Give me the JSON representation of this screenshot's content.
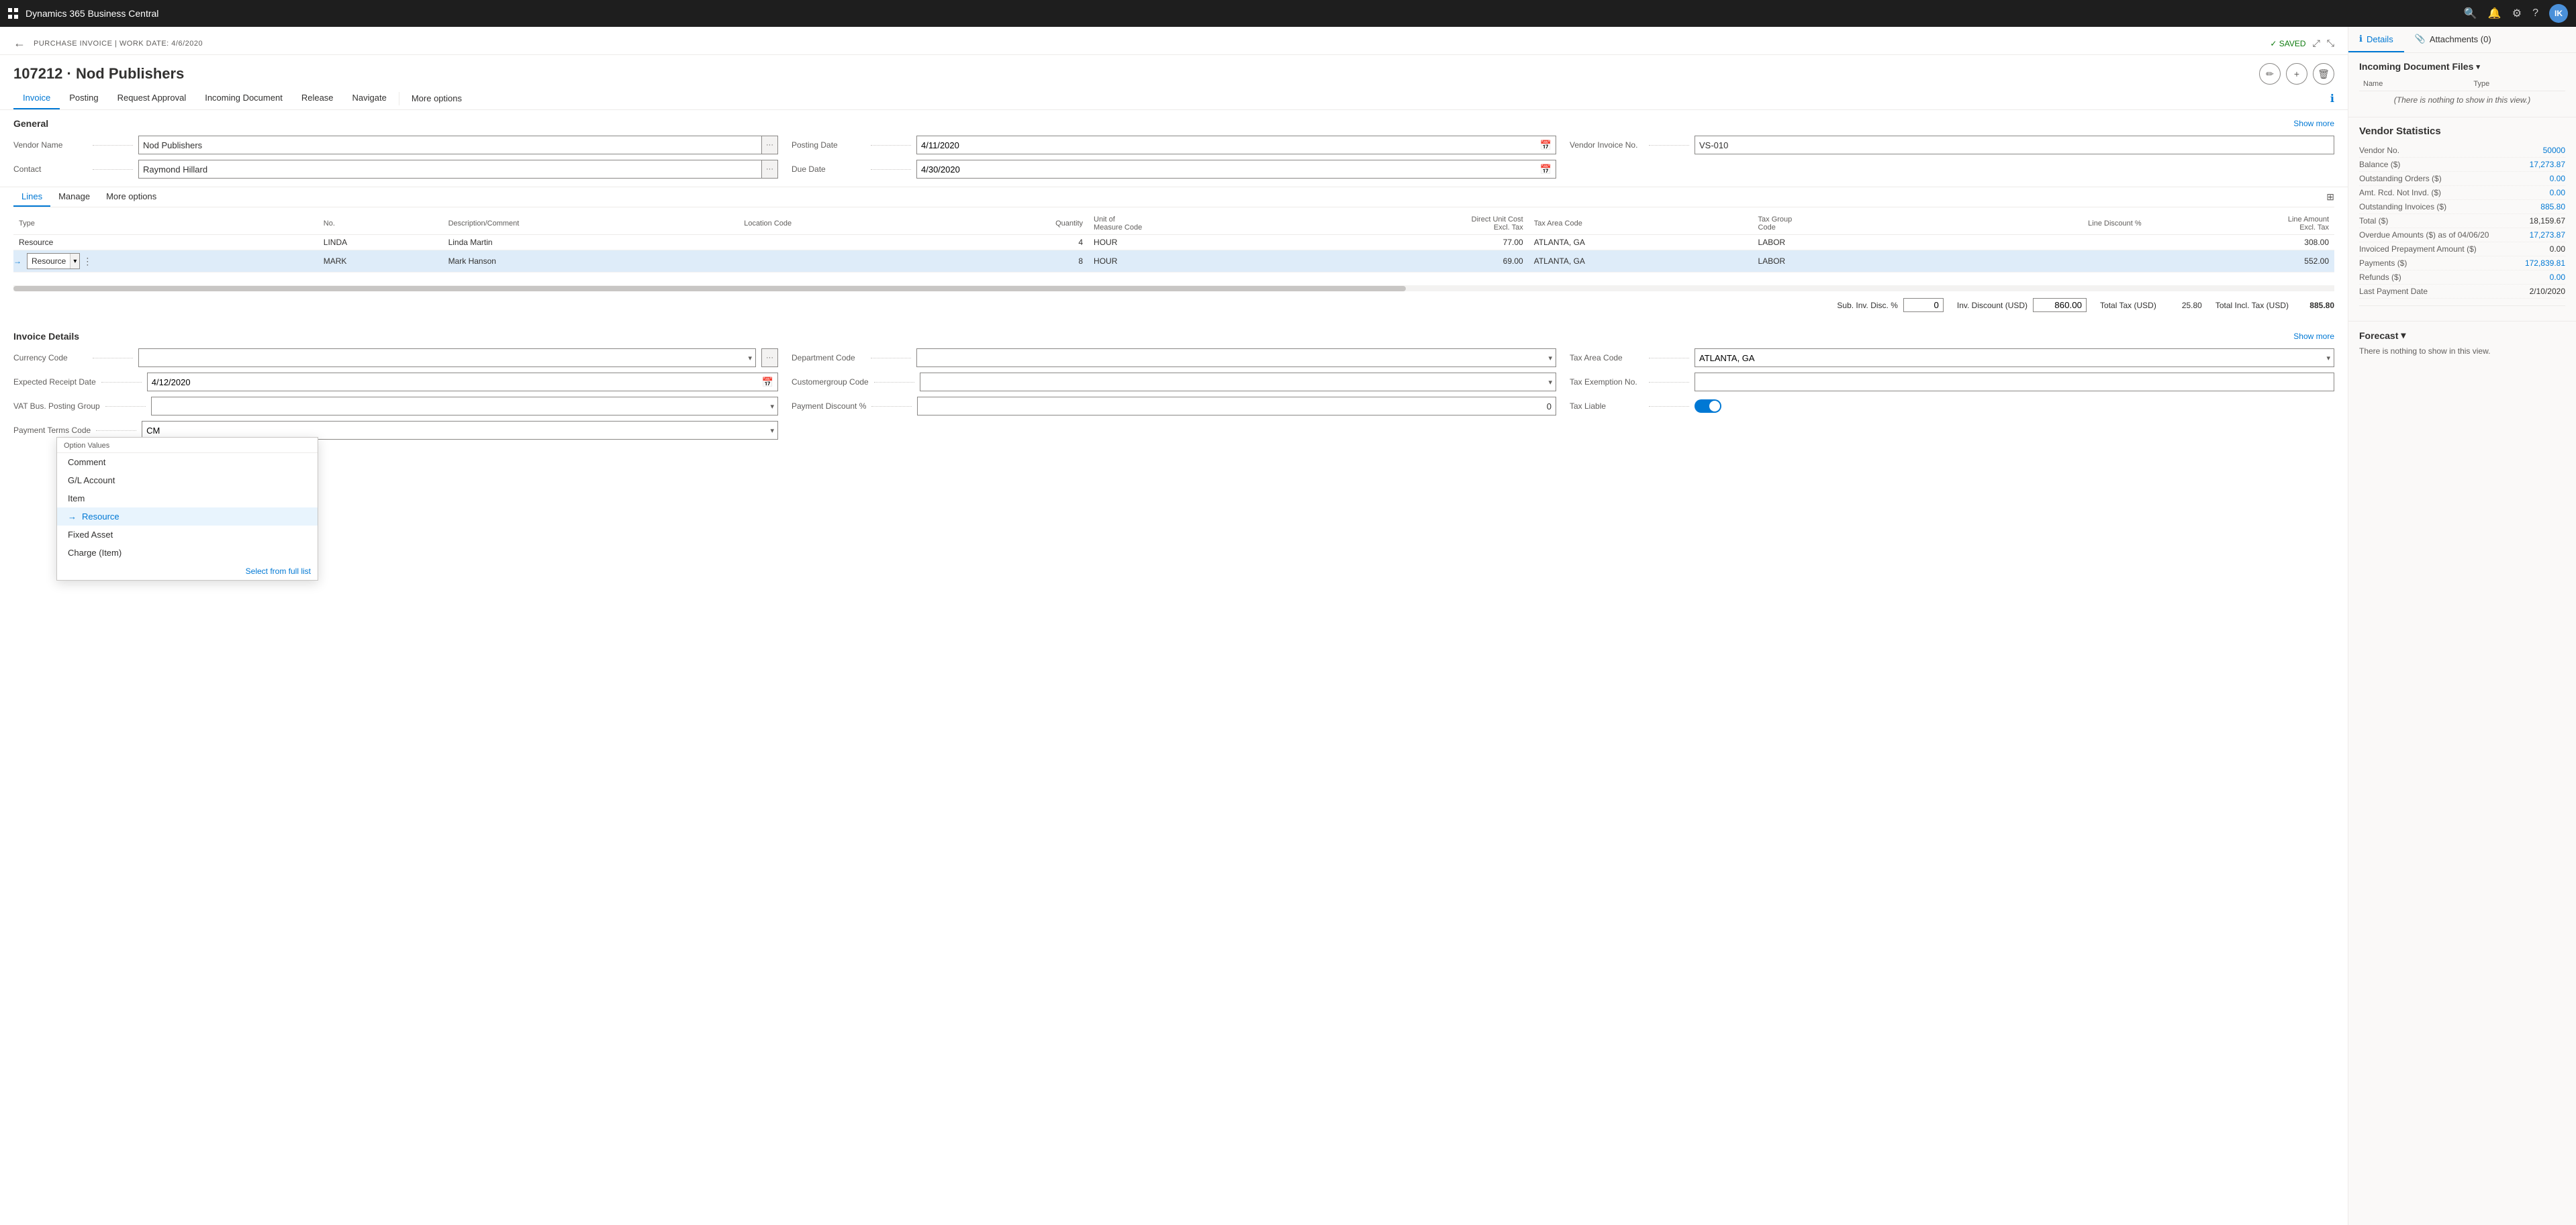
{
  "topBar": {
    "appName": "Dynamics 365 Business Central",
    "avatarInitials": "IK"
  },
  "subHeader": {
    "breadcrumb": "PURCHASE INVOICE | WORK DATE: 4/6/2020",
    "savedLabel": "✓ SAVED"
  },
  "pageTitle": "107212 · Nod Publishers",
  "tabs": [
    {
      "label": "Invoice",
      "active": true
    },
    {
      "label": "Posting"
    },
    {
      "label": "Request Approval"
    },
    {
      "label": "Incoming Document"
    },
    {
      "label": "Release"
    },
    {
      "label": "Navigate"
    },
    {
      "label": "More options",
      "isSeparated": true
    }
  ],
  "general": {
    "sectionTitle": "General",
    "showMore": "Show more",
    "vendorNameLabel": "Vendor Name",
    "vendorNameValue": "Nod Publishers",
    "contactLabel": "Contact",
    "contactValue": "Raymond Hillard",
    "postingDateLabel": "Posting Date",
    "postingDateValue": "4/11/2020",
    "dueDateLabel": "Due Date",
    "dueDateValue": "4/30/2020",
    "vendorInvoiceNoLabel": "Vendor Invoice No.",
    "vendorInvoiceNoValue": "VS-010"
  },
  "linesTabs": [
    {
      "label": "Lines",
      "active": true
    },
    {
      "label": "Manage"
    },
    {
      "label": "More options"
    }
  ],
  "linesTable": {
    "columns": [
      "Type",
      "No.",
      "Description/Comment",
      "Location Code",
      "Quantity",
      "Unit of Measure Code",
      "Direct Unit Cost Excl. Tax",
      "Tax Area Code",
      "Tax Group Code",
      "Line Discount %",
      "Line Amount Excl. Tax"
    ],
    "rows": [
      {
        "type": "Resource",
        "no": "LINDA",
        "desc": "Linda Martin",
        "locCode": "",
        "qty": "4",
        "uom": "HOUR",
        "directCost": "77.00",
        "taxArea": "ATLANTA, GA",
        "taxGroup": "LABOR",
        "lineDisc": "",
        "lineAmt": "308.00"
      },
      {
        "type": "Resource",
        "no": "MARK",
        "desc": "Mark Hanson",
        "locCode": "",
        "qty": "8",
        "uom": "HOUR",
        "directCost": "69.00",
        "taxArea": "ATLANTA, GA",
        "taxGroup": "LABOR",
        "lineDisc": "",
        "lineAmt": "552.00",
        "active": true
      }
    ]
  },
  "dropdown": {
    "title": "Option Values",
    "items": [
      {
        "label": "Comment",
        "selected": false
      },
      {
        "label": "G/L Account",
        "selected": false
      },
      {
        "label": "Item",
        "selected": false
      },
      {
        "label": "Resource",
        "selected": true
      },
      {
        "label": "Fixed Asset",
        "selected": false
      },
      {
        "label": "Charge (Item)",
        "selected": false
      }
    ],
    "selectFullList": "Select from full list"
  },
  "totals": {
    "subInvDiscPct": "Sub. Inv. Disc. %",
    "subInvDiscPctValue": "0",
    "invDiscountUSD": "Inv. Discount (USD)",
    "invDiscountValue": "860.00",
    "totalTaxUSD": "Total Tax (USD)",
    "totalTaxValue": "25.80",
    "totalInclTaxUSD": "Total Incl. Tax (USD)",
    "totalInclTaxValue": "885.80"
  },
  "invoiceDetails": {
    "sectionTitle": "Invoice Details",
    "showMore": "Show more",
    "currencyCodeLabel": "Currency Code",
    "currencyCodeValue": "",
    "expectedReceiptDateLabel": "Expected Receipt Date",
    "expectedReceiptDateValue": "4/12/2020",
    "vatBusPostingGroupLabel": "VAT Bus. Posting Group",
    "vatBusPostingGroupValue": "",
    "paymentTermsCodeLabel": "Payment Terms Code",
    "paymentTermsCodeValue": "CM",
    "departmentCodeLabel": "Department Code",
    "departmentCodeValue": "",
    "customergroupCodeLabel": "Customergroup Code",
    "customergroupCodeValue": "",
    "paymentDiscountPctLabel": "Payment Discount %",
    "paymentDiscountPctValue": "0",
    "taxAreaCodeLabel": "Tax Area Code",
    "taxAreaCodeValue": "ATLANTA, GA",
    "taxExemptionNoLabel": "Tax Exemption No.",
    "taxExemptionNoValue": "",
    "taxLiableLabel": "Tax Liable",
    "taxLiableValue": true
  },
  "rightPanel": {
    "tabs": [
      {
        "label": "Details",
        "active": true,
        "icon": "ℹ"
      },
      {
        "label": "Attachments (0)",
        "icon": "📎"
      }
    ],
    "incomingDocTitle": "Incoming Document Files",
    "incomingDocColumns": [
      "Name",
      "Type"
    ],
    "incomingDocEmpty": "(There is nothing to show in this view.)",
    "vendorStats": {
      "title": "Vendor Statistics",
      "rows": [
        {
          "label": "Vendor No.",
          "value": "50000",
          "type": "link"
        },
        {
          "label": "Balance ($)",
          "value": "17,273.87",
          "type": "link"
        },
        {
          "label": "Outstanding Orders ($)",
          "value": "0.00",
          "type": "link"
        },
        {
          "label": "Amt. Rcd. Not Invd. ($)",
          "value": "0.00",
          "type": "link"
        },
        {
          "label": "Outstanding Invoices ($)",
          "value": "885.80",
          "type": "link"
        },
        {
          "label": "Total ($)",
          "value": "18,159.67",
          "type": "black"
        },
        {
          "label": "Overdue Amounts ($) as of 04/06/20",
          "value": "17,273.87",
          "type": "link"
        },
        {
          "label": "Invoiced Prepayment Amount ($)",
          "value": "0.00",
          "type": "black"
        },
        {
          "label": "Payments ($)",
          "value": "172,839.81",
          "type": "link"
        },
        {
          "label": "Refunds ($)",
          "value": "0.00",
          "type": "link"
        },
        {
          "label": "Last Payment Date",
          "value": "2/10/2020",
          "type": "black"
        }
      ]
    },
    "forecast": {
      "title": "Forecast",
      "empty": "There is nothing to show in this view."
    }
  }
}
